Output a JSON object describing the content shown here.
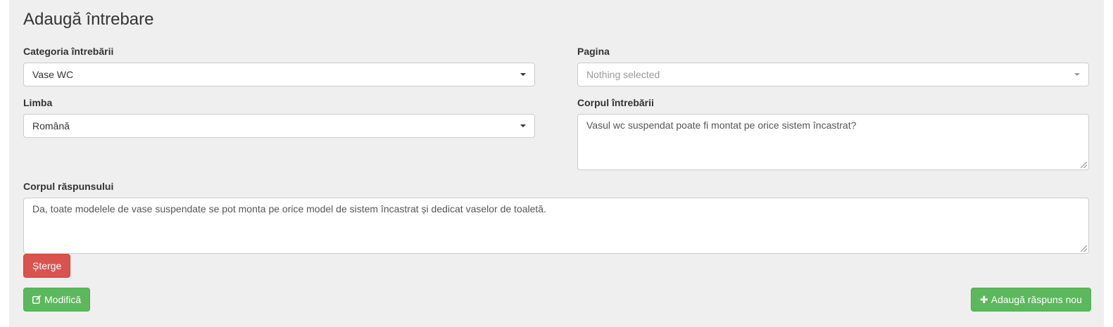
{
  "page": {
    "title": "Adaugă întrebare"
  },
  "form": {
    "category": {
      "label": "Categoria întrebării",
      "value": "Vase WC"
    },
    "page_field": {
      "label": "Pagina",
      "placeholder": "Nothing selected"
    },
    "language": {
      "label": "Limba",
      "value": "Română"
    },
    "question_body": {
      "label": "Corpul întrebării",
      "value": "Vasul wc suspendat poate fi montat pe orice sistem încastrat?"
    },
    "answer_body": {
      "label": "Corpul răspunsului",
      "value": "Da, toate modelele de vase suspendate se pot monta pe orice model de sistem încastrat și dedicat vaselor de toaletă."
    }
  },
  "buttons": {
    "delete_label": "Șterge",
    "modify_label": "Modifică",
    "add_answer_label": "Adaugă răspuns nou"
  },
  "icons": {
    "modify": "edit-icon",
    "add": "plus-icon",
    "dropdown": "caret-down-icon"
  },
  "colors": {
    "background": "#efefef",
    "danger": "#d9534f",
    "success": "#5cb85c"
  }
}
